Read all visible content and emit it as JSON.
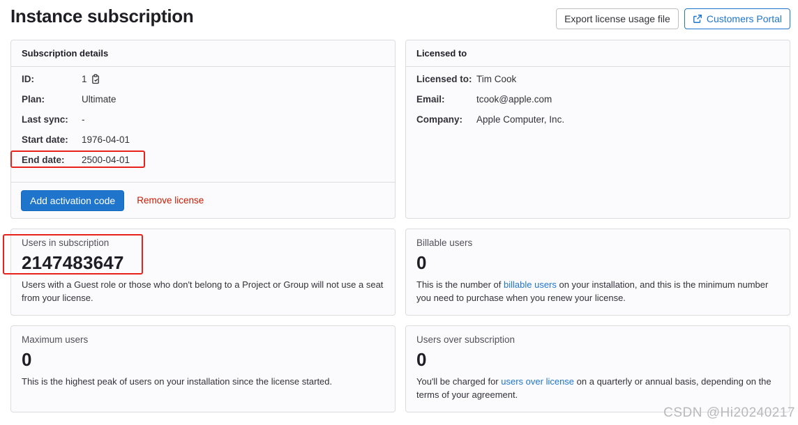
{
  "page": {
    "title": "Instance subscription"
  },
  "header_actions": {
    "export_label": "Export license usage file",
    "portal_label": "Customers Portal"
  },
  "subscription": {
    "header": "Subscription details",
    "rows": [
      {
        "label": "ID:",
        "value": "1"
      },
      {
        "label": "Plan:",
        "value": "Ultimate"
      },
      {
        "label": "Last sync:",
        "value": "-"
      },
      {
        "label": "Start date:",
        "value": "1976-04-01"
      },
      {
        "label": "End date:",
        "value": "2500-04-01"
      }
    ],
    "add_activation_label": "Add activation code",
    "remove_license_label": "Remove license"
  },
  "licensed_to": {
    "header": "Licensed to",
    "rows": [
      {
        "label": "Licensed to:",
        "value": "Tim Cook"
      },
      {
        "label": "Email:",
        "value": "tcook@apple.com"
      },
      {
        "label": "Company:",
        "value": "Apple Computer, Inc."
      }
    ]
  },
  "stats": {
    "users_in_subscription": {
      "label": "Users in subscription",
      "value": "2147483647",
      "desc": "Users with a Guest role or those who don't belong to a Project or Group will not use a seat from your license."
    },
    "billable_users": {
      "label": "Billable users",
      "value": "0",
      "desc_before": "This is the number of ",
      "desc_link": "billable users",
      "desc_after": " on your installation, and this is the minimum number you need to purchase when you renew your license."
    },
    "maximum_users": {
      "label": "Maximum users",
      "value": "0",
      "desc": "This is the highest peak of users on your installation since the license started."
    },
    "users_over_subscription": {
      "label": "Users over subscription",
      "value": "0",
      "desc_before": "You'll be charged for ",
      "desc_link": "users over license",
      "desc_after": " on a quarterly or annual basis, depending on the terms of your agreement."
    }
  },
  "watermark": "CSDN @Hi20240217",
  "colors": {
    "accent": "#1f75cb",
    "danger": "#c91c00",
    "highlight": "#e8221b"
  },
  "icons": {
    "external_link": "external-link-icon",
    "copy": "copy-to-clipboard-icon"
  }
}
